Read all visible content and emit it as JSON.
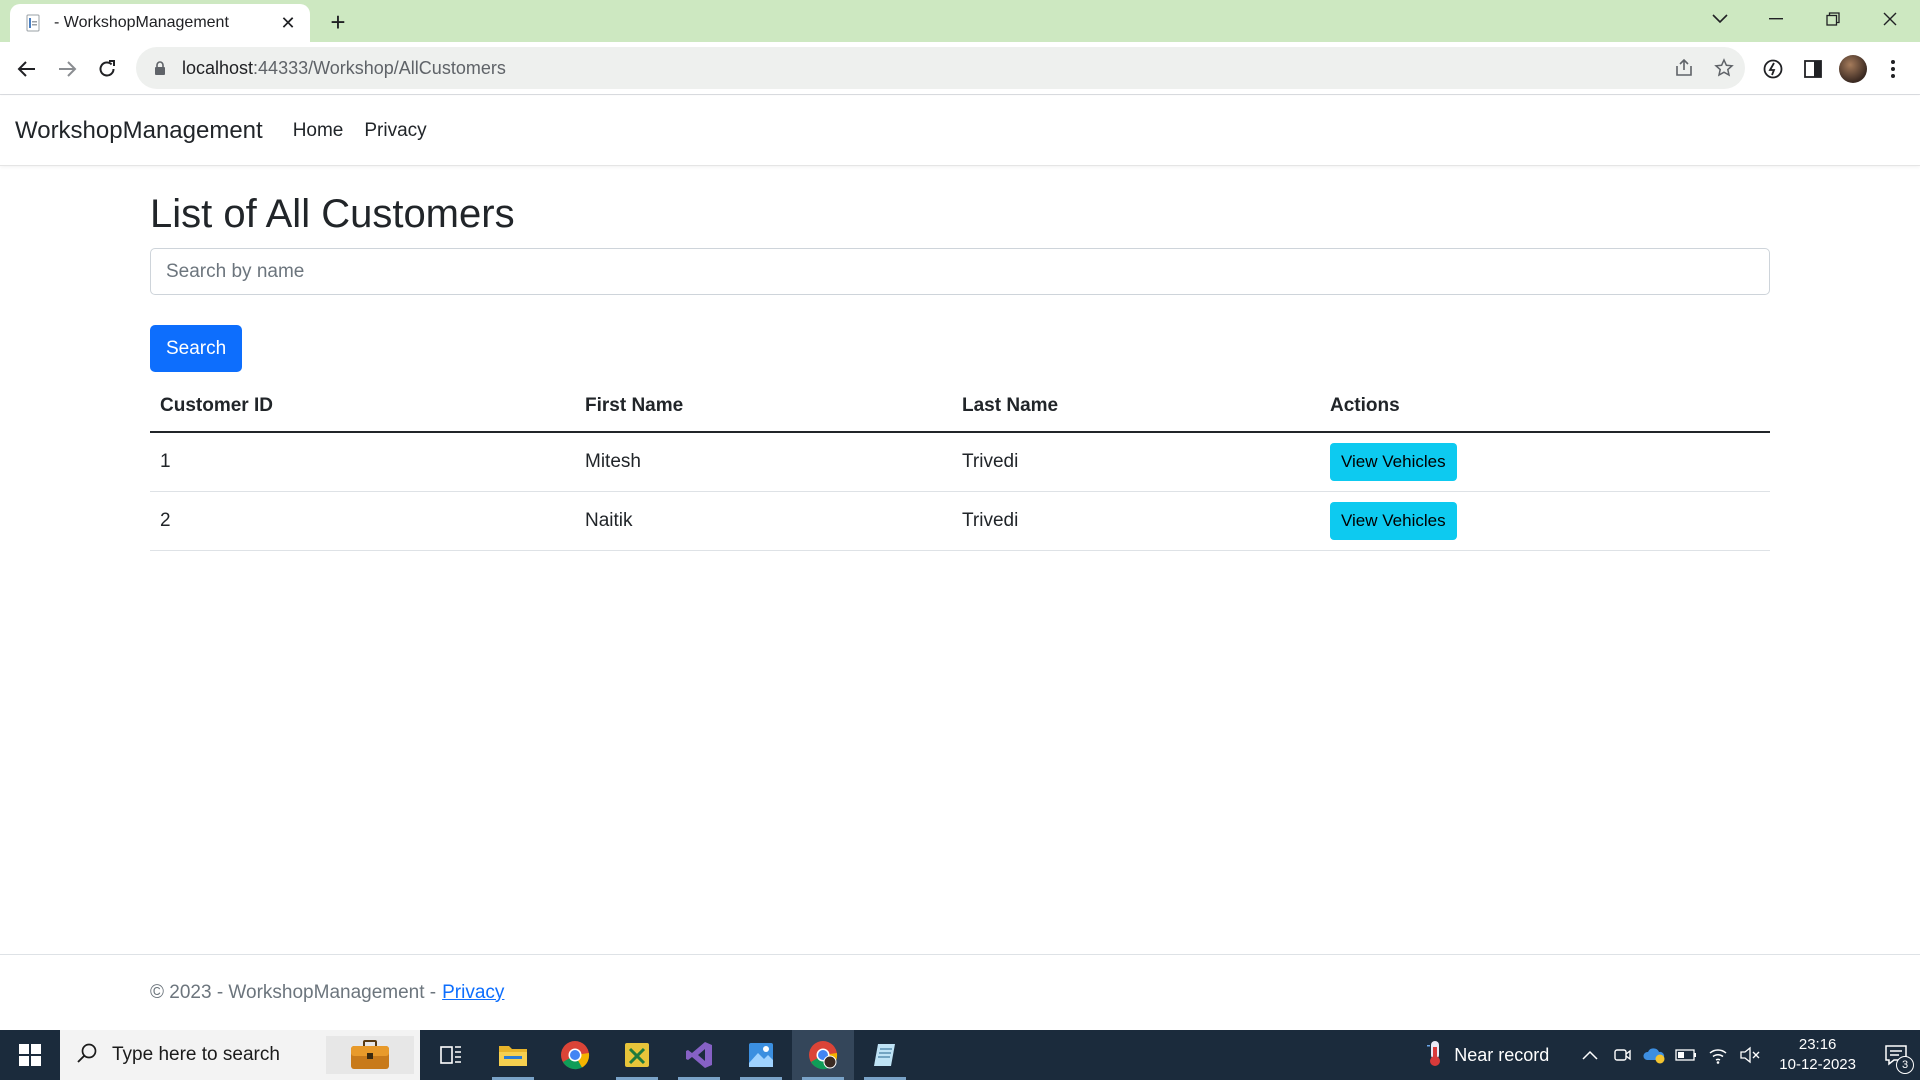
{
  "browser": {
    "tab_title": "- WorkshopManagement",
    "url_host": "localhost",
    "url_rest": ":44333/Workshop/AllCustomers"
  },
  "site": {
    "brand": "WorkshopManagement",
    "nav": {
      "home": "Home",
      "privacy": "Privacy"
    }
  },
  "page": {
    "title": "List of All Customers",
    "search_placeholder": "Search by name",
    "search_button": "Search"
  },
  "table": {
    "headers": [
      "Customer ID",
      "First Name",
      "Last Name",
      "Actions"
    ],
    "rows": [
      {
        "id": "1",
        "first": "Mitesh",
        "last": "Trivedi",
        "action": "View Vehicles"
      },
      {
        "id": "2",
        "first": "Naitik",
        "last": "Trivedi",
        "action": "View Vehicles"
      }
    ]
  },
  "footer": {
    "text": "© 2023 - WorkshopManagement -",
    "link": "Privacy"
  },
  "taskbar": {
    "search_placeholder": "Type here to search",
    "weather": "Near record",
    "time": "23:16",
    "date": "10-12-2023",
    "notification_count": "3"
  },
  "colors": {
    "primary": "#0d6efd",
    "info": "#0dcaf0",
    "tabbar": "#cde8c1",
    "taskbar": "#1b2b3c"
  }
}
